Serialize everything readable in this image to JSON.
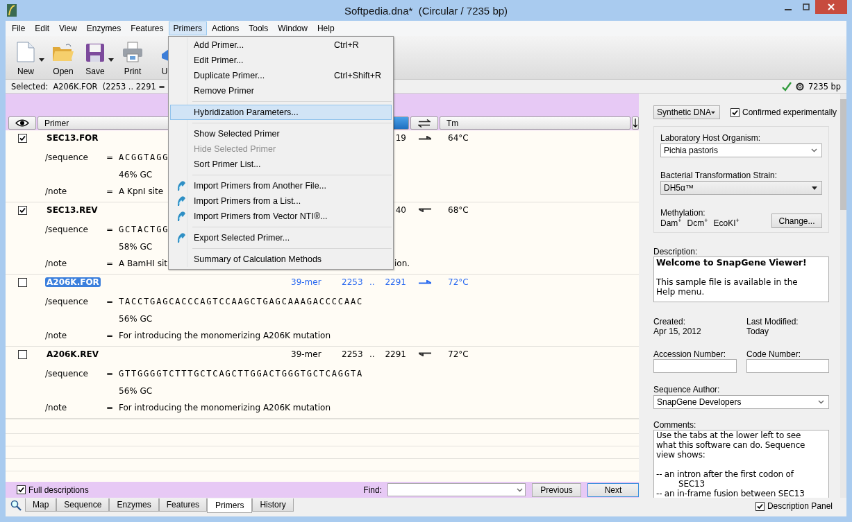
{
  "window": {
    "title": "Softpedia.dna*  (Circular / 7235 bp)"
  },
  "menu_bar": [
    {
      "label": "File",
      "selected": false
    },
    {
      "label": "Edit",
      "selected": false
    },
    {
      "label": "View",
      "selected": false
    },
    {
      "label": "Enzymes",
      "selected": false
    },
    {
      "label": "Features",
      "selected": false
    },
    {
      "label": "Primers",
      "selected": true
    },
    {
      "label": "Actions",
      "selected": false
    },
    {
      "label": "Tools",
      "selected": false
    },
    {
      "label": "Window",
      "selected": false
    },
    {
      "label": "Help",
      "selected": false
    }
  ],
  "toolbar": [
    {
      "kind": "new",
      "label": "New",
      "dropdown": true
    },
    {
      "kind": "open",
      "label": "Open",
      "dropdown": false
    },
    {
      "kind": "save",
      "label": "Save",
      "dropdown": true
    },
    {
      "kind": "print",
      "label": "Print",
      "dropdown": false
    },
    {
      "kind": "partial",
      "label": "U",
      "dropdown": false
    }
  ],
  "selection_info": "Selected:  A206K.FOR  (2253 .. 2291 =",
  "sequence_length": "7235 bp",
  "columns": [
    {
      "label": "Primer"
    },
    {
      "label": "Tm"
    }
  ],
  "primers": [
    {
      "name": "SEC13.FOR",
      "checked": true,
      "selected": false,
      "end": "19",
      "reverse": false,
      "tm": "64°C",
      "fields": [
        {
          "label": "/sequence",
          "eq": "=",
          "value": "ACGGTAGG",
          "kind": "mono"
        },
        {
          "value": "46% GC",
          "kind": "plain"
        },
        {
          "label": "/note",
          "eq": "=",
          "value": "A KpnI site",
          "kind": "plain"
        }
      ]
    },
    {
      "name": "SEC13.REV",
      "checked": true,
      "selected": false,
      "end": "40",
      "reverse": true,
      "tm": "68°C",
      "fields": [
        {
          "label": "/sequence",
          "eq": "=",
          "value": "GCTACTGG",
          "kind": "mono"
        },
        {
          "value": "58% GC",
          "kind": "plain"
        },
        {
          "label": "/note",
          "eq": "=",
          "value": "A BamHI sit",
          "tail": "ion.",
          "kind": "plain"
        }
      ]
    },
    {
      "name": "A206K.FOR",
      "checked": false,
      "selected": true,
      "length": "39-mer",
      "start": "2253",
      "dots": "..",
      "end": "2291",
      "reverse": false,
      "tm": "72°C",
      "fields": [
        {
          "label": "/sequence",
          "eq": "=",
          "value": "TACCTGAGCACCCAGTCCAAGCTGAGCAAAGACCCCAAC",
          "kind": "mono"
        },
        {
          "value": "56% GC",
          "kind": "plain"
        },
        {
          "label": "/note",
          "eq": "=",
          "value": "For introducing the monomerizing A206K mutation",
          "kind": "plain"
        }
      ]
    },
    {
      "name": "A206K.REV",
      "checked": false,
      "selected": false,
      "length": "39-mer",
      "start": "2253",
      "dots": "..",
      "end": "2291",
      "reverse": true,
      "tm": "72°C",
      "fields": [
        {
          "label": "/sequence",
          "eq": "=",
          "value": "GTTGGGGTCTTTGCTCAGCTTGGACTGGGTGCTCAGGTA",
          "kind": "mono"
        },
        {
          "value": "56% GC",
          "kind": "plain"
        },
        {
          "label": "/note",
          "eq": "=",
          "value": "For introducing the monomerizing A206K mutation",
          "kind": "plain"
        }
      ]
    }
  ],
  "primers_menu": [
    {
      "kind": "item",
      "label": "Add Primer...",
      "shortcut": "Ctrl+R",
      "icon": false,
      "disabled": false,
      "selected": false
    },
    {
      "kind": "item",
      "label": "Edit Primer...",
      "icon": false,
      "disabled": false,
      "selected": false
    },
    {
      "kind": "item",
      "label": "Duplicate Primer...",
      "shortcut": "Ctrl+Shift+R",
      "icon": false,
      "disabled": false,
      "selected": false
    },
    {
      "kind": "item",
      "label": "Remove Primer",
      "icon": false,
      "disabled": false,
      "selected": false
    },
    {
      "kind": "separator"
    },
    {
      "kind": "item",
      "label": "Hybridization Parameters...",
      "icon": false,
      "disabled": false,
      "selected": true
    },
    {
      "kind": "separator"
    },
    {
      "kind": "item",
      "label": "Show Selected Primer",
      "icon": false,
      "disabled": false,
      "selected": false
    },
    {
      "kind": "item",
      "label": "Hide Selected Primer",
      "icon": false,
      "disabled": true,
      "selected": false
    },
    {
      "kind": "item",
      "label": "Sort Primer List...",
      "icon": false,
      "disabled": false,
      "selected": false
    },
    {
      "kind": "separator"
    },
    {
      "kind": "item",
      "label": "Import Primers from Another File...",
      "icon": true,
      "disabled": false,
      "selected": false
    },
    {
      "kind": "item",
      "label": "Import Primers from a List...",
      "icon": true,
      "disabled": false,
      "selected": false
    },
    {
      "kind": "item",
      "label": "Import Primers from Vector NTI®...",
      "icon": true,
      "disabled": false,
      "selected": false
    },
    {
      "kind": "separator"
    },
    {
      "kind": "item",
      "label": "Export Selected Primer...",
      "icon": true,
      "disabled": false,
      "selected": false
    },
    {
      "kind": "separator"
    },
    {
      "kind": "item",
      "label": "Summary of Calculation Methods",
      "icon": false,
      "disabled": false,
      "selected": false
    }
  ],
  "find_bar": {
    "full_descriptions": {
      "label": "Full descriptions",
      "checked": true
    },
    "find_label": "Find:",
    "previous": "Previous",
    "next": "Next"
  },
  "view_tabs": [
    {
      "label": "Map",
      "selected": false
    },
    {
      "label": "Sequence",
      "selected": false
    },
    {
      "label": "Enzymes",
      "selected": false
    },
    {
      "label": "Features",
      "selected": false
    },
    {
      "label": "Primers",
      "selected": true
    },
    {
      "label": "History",
      "selected": false
    }
  ],
  "description_panel": {
    "dna_type": "Synthetic DNA",
    "confirmed": {
      "label": "Confirmed experimentally",
      "checked": true
    },
    "host_label": "Laboratory Host Organism:",
    "host": "Pichia pastoris",
    "strain_label": "Bacterial Transformation Strain:",
    "strain": "DH5α™",
    "methylation_label": "Methylation:",
    "methylation": [
      "Dam$^{+}$",
      "Dcm$^{+}$",
      "EcoKI$^{+}$"
    ],
    "change_button": "Change...",
    "description_label": "Description:",
    "description_title": "Welcome to SnapGene Viewer!",
    "description_text": "This sample file is available in the Help menu.",
    "created_label": "Created:",
    "created": "Apr 15, 2012",
    "modified_label": "Last Modified:",
    "modified": "Today",
    "accession_label": "Accession Number:",
    "code_label": "Code Number:",
    "author_label": "Sequence Author:",
    "author": "SnapGene Developers",
    "comments_label": "Comments:",
    "comments": [
      {
        "kind": "paragraph",
        "text": "Use the tabs at the lower left to see what this software can do. Sequence view shows:"
      },
      {
        "kind": "spaced",
        "text": "-- an intron after the first codon of"
      },
      {
        "kind": "continuation",
        "text": "SEC13"
      },
      {
        "kind": "line",
        "text": "-- an in-frame fusion between SEC13"
      }
    ],
    "panel_toggle": {
      "label": "Description Panel",
      "checked": true
    }
  }
}
